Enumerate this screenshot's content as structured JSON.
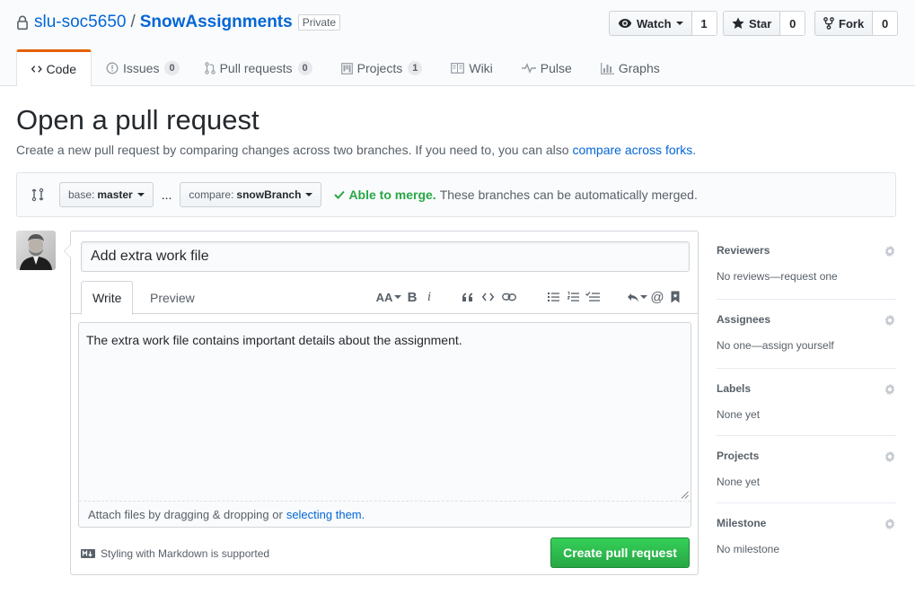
{
  "repo": {
    "owner": "slu-soc5650",
    "separator": "/",
    "name": "SnowAssignments",
    "visibility": "Private"
  },
  "social": {
    "watch_label": "Watch",
    "watch_count": "1",
    "star_label": "Star",
    "star_count": "0",
    "fork_label": "Fork",
    "fork_count": "0"
  },
  "nav": {
    "code": "Code",
    "issues": "Issues",
    "issues_count": "0",
    "pulls": "Pull requests",
    "pulls_count": "0",
    "projects": "Projects",
    "projects_count": "1",
    "wiki": "Wiki",
    "pulse": "Pulse",
    "graphs": "Graphs"
  },
  "page": {
    "title": "Open a pull request",
    "description": "Create a new pull request by comparing changes across two branches. If you need to, you can also",
    "forks_link": "compare across forks."
  },
  "range": {
    "base_prefix": "base:",
    "base_branch": "master",
    "dots": "...",
    "compare_prefix": "compare:",
    "compare_branch": "snowBranch",
    "status_ok": "Able to merge.",
    "status_detail": "These branches can be automatically merged."
  },
  "form": {
    "title_value": "Add extra work file",
    "tab_write": "Write",
    "tab_preview": "Preview",
    "toolbar_header": "AA",
    "toolbar_bold": "B",
    "toolbar_italic": "i",
    "toolbar_mention": "@",
    "body_value": "The extra work file contains important details about the assignment.",
    "attach_text": "Attach files by dragging & dropping or",
    "attach_link": "selecting them.",
    "markdown_note": "Styling with Markdown is supported",
    "submit_label": "Create pull request"
  },
  "sidebar": {
    "reviewers_title": "Reviewers",
    "reviewers_value": "No reviews—request one",
    "assignees_title": "Assignees",
    "assignees_value": "No one—assign yourself",
    "labels_title": "Labels",
    "labels_value": "None yet",
    "projects_title": "Projects",
    "projects_value": "None yet",
    "milestone_title": "Milestone",
    "milestone_value": "No milestone"
  },
  "colors": {
    "link": "#0366d6",
    "accent_tab": "#e36209",
    "success": "#28a745",
    "text_muted": "#586069"
  }
}
